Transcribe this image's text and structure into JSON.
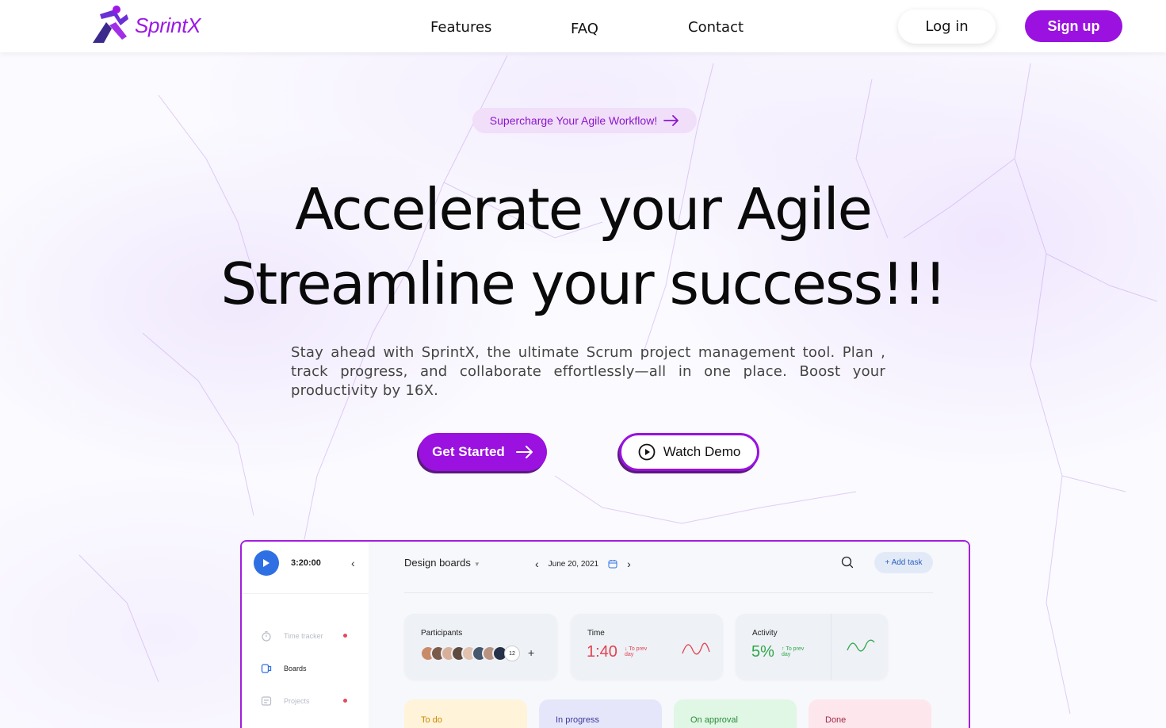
{
  "brand": {
    "name": "SprintX",
    "color": "#9b18e6",
    "logo_icon": "running-figure-icon"
  },
  "nav": {
    "features": "Features",
    "faq": "FAQ",
    "contact": "Contact"
  },
  "auth": {
    "login": "Log in",
    "signup": "Sign up"
  },
  "hero": {
    "pill": "Supercharge Your Agile Workflow!",
    "title_line1": "Accelerate your Agile",
    "title_line2": "Streamline your success!!!",
    "subtitle": "Stay ahead with SprintX, the ultimate Scrum project management tool. Plan , track progress, and collaborate effortlessly—all in one place. Boost your productivity by 16X.",
    "cta_primary": "Get Started",
    "cta_secondary": "Watch Demo"
  },
  "colors": {
    "accent": "#9a11e0",
    "pill_bg": "#f1def9"
  },
  "preview": {
    "timer": "3:20:00",
    "sidebar": [
      {
        "label": "Time tracker",
        "icon": "stopwatch-icon",
        "muted": true
      },
      {
        "label": "Boards",
        "icon": "board-icon",
        "muted": false
      },
      {
        "label": "Projects",
        "icon": "folder-icon",
        "muted": true
      }
    ],
    "board_title": "Design boards",
    "date": "June 20, 2021",
    "add_task": "+ Add task",
    "stats": {
      "participants": {
        "label": "Participants",
        "count": "12"
      },
      "time": {
        "label": "Time",
        "value": "1:40",
        "hint": "To prev day"
      },
      "activity": {
        "label": "Activity",
        "value": "5%",
        "hint": "To prev day"
      }
    },
    "columns": [
      {
        "label": "To do",
        "color": "#fff3d9",
        "text": "#c98a00"
      },
      {
        "label": "In progress",
        "color": "#e6e6fb",
        "text": "#3a3a9a"
      },
      {
        "label": "On approval",
        "color": "#dff7e4",
        "text": "#2b8a3e"
      },
      {
        "label": "Done",
        "color": "#fde6ec",
        "text": "#a02a48"
      }
    ]
  }
}
